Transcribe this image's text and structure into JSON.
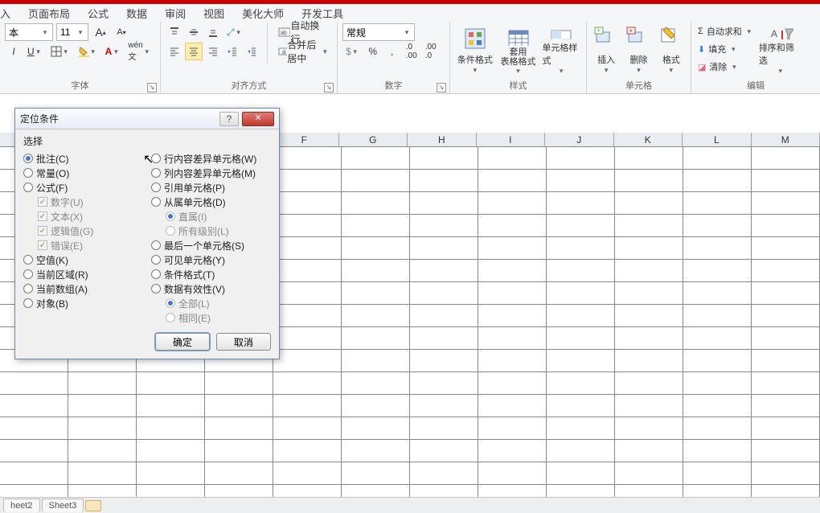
{
  "menu": [
    "入",
    "页面布局",
    "公式",
    "数据",
    "审阅",
    "视图",
    "美化大师",
    "开发工具"
  ],
  "ribbon": {
    "font": {
      "label": "字体",
      "name_val": "本",
      "size_val": "11",
      "grow": "A",
      "shrink": "A"
    },
    "align": {
      "label": "对齐方式",
      "wrap": "自动换行",
      "merge": "合并后居中"
    },
    "number": {
      "label": "数字",
      "fmt": "常规"
    },
    "styles": {
      "label": "样式",
      "cond": "条件格式",
      "table": "套用\n表格格式",
      "cell": "单元格样式"
    },
    "cells": {
      "label": "单元格",
      "insert": "插入",
      "delete": "删除",
      "format": "格式"
    },
    "edit": {
      "label": "编辑",
      "sum": "自动求和",
      "fill": "填充",
      "clear": "清除",
      "sort": "排序和筛选"
    }
  },
  "columns": [
    "F",
    "G",
    "H",
    "I",
    "J",
    "K",
    "L",
    "M"
  ],
  "sheet_tabs": [
    "heet2",
    "Sheet3"
  ],
  "dialog": {
    "title": "定位条件",
    "section": "选择",
    "left": [
      {
        "t": "批注(C)",
        "sel": true
      },
      {
        "t": "常量(O)"
      },
      {
        "t": "公式(F)"
      },
      {
        "t": "数字(U)",
        "chk": true,
        "ind": 1,
        "dis": true
      },
      {
        "t": "文本(X)",
        "chk": true,
        "ind": 1,
        "dis": true
      },
      {
        "t": "逻辑值(G)",
        "chk": true,
        "ind": 1,
        "dis": true
      },
      {
        "t": "错误(E)",
        "chk": true,
        "ind": 1,
        "dis": true
      },
      {
        "t": "空值(K)"
      },
      {
        "t": "当前区域(R)"
      },
      {
        "t": "当前数组(A)"
      },
      {
        "t": "对象(B)"
      }
    ],
    "right": [
      {
        "t": "行内容差异单元格(W)"
      },
      {
        "t": "列内容差异单元格(M)"
      },
      {
        "t": "引用单元格(P)"
      },
      {
        "t": "从属单元格(D)"
      },
      {
        "t": "直属(I)",
        "ind": 1,
        "dis": true,
        "sel": true
      },
      {
        "t": "所有级别(L)",
        "ind": 1,
        "dis": true
      },
      {
        "t": "最后一个单元格(S)"
      },
      {
        "t": "可见单元格(Y)"
      },
      {
        "t": "条件格式(T)"
      },
      {
        "t": "数据有效性(V)"
      },
      {
        "t": "全部(L)",
        "ind": 1,
        "dis": true,
        "sel": true
      },
      {
        "t": "相同(E)",
        "ind": 1,
        "dis": true
      }
    ],
    "ok": "确定",
    "cancel": "取消"
  }
}
